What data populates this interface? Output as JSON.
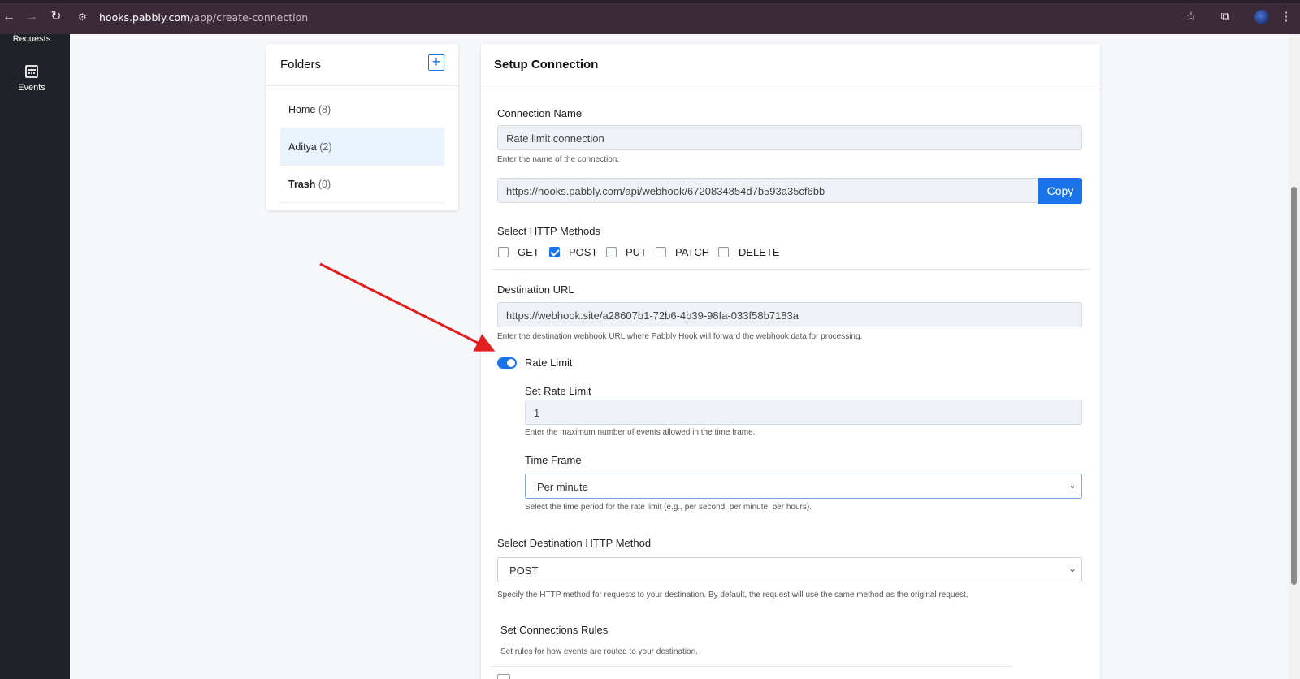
{
  "browser": {
    "url_host": "hooks.pabbly.com",
    "url_path": "/app/create-connection"
  },
  "sidebar": {
    "items": [
      {
        "label": "Requests"
      },
      {
        "label": "Events",
        "icon": "calendar-icon"
      }
    ]
  },
  "folders": {
    "title": "Folders",
    "add_icon": "+",
    "items": [
      {
        "name": "Home",
        "count": "(8)"
      },
      {
        "name": "Aditya",
        "count": "(2)"
      },
      {
        "name": "Trash",
        "count": "(0)"
      }
    ]
  },
  "setup": {
    "title": "Setup Connection",
    "connection_name": {
      "label": "Connection Name",
      "value": "Rate limit connection",
      "help": "Enter the name of the connection."
    },
    "webhook_url": {
      "value": "https://hooks.pabbly.com/api/webhook/6720834854d7b593a35cf6bb",
      "copy_label": "Copy"
    },
    "http_methods": {
      "label": "Select HTTP Methods",
      "options": [
        {
          "label": "GET",
          "checked": false
        },
        {
          "label": "POST",
          "checked": true
        },
        {
          "label": "PUT",
          "checked": false
        },
        {
          "label": "PATCH",
          "checked": false
        },
        {
          "label": "DELETE",
          "checked": false
        }
      ]
    },
    "destination_url": {
      "label": "Destination URL",
      "value": "https://webhook.site/a28607b1-72b6-4b39-98fa-033f58b7183a",
      "help": "Enter the destination webhook URL where Pabbly Hook will forward the webhook data for processing."
    },
    "rate_limit": {
      "toggle_label": "Rate Limit",
      "enabled": true,
      "set_label": "Set Rate Limit",
      "value": "1",
      "help": "Enter the maximum number of events allowed in the time frame.",
      "time_frame_label": "Time Frame",
      "time_frame_value": "Per minute",
      "time_frame_help": "Select the time period for the rate limit (e.g., per second, per minute, per hours)."
    },
    "destination_method": {
      "label": "Select Destination HTTP Method",
      "value": "POST",
      "help": "Specify the HTTP method for requests to your destination. By default, the request will use the same method as the original request."
    },
    "rules": {
      "label": "Set Connections Rules",
      "help": "Set rules for how events are routed to your destination."
    }
  },
  "colors": {
    "accent": "#1a73e8",
    "sidebar_bg": "#1f2327",
    "chrome_bg": "#3b2b38",
    "annotation_arrow": "#e02020"
  }
}
